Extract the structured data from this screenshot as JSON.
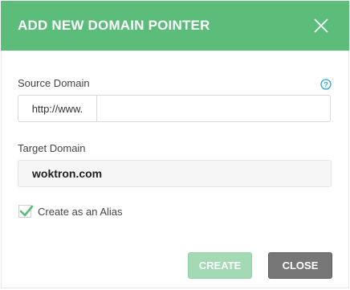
{
  "dialog": {
    "title": "ADD NEW DOMAIN POINTER",
    "close_icon": "close-x-icon"
  },
  "source": {
    "label": "Source Domain",
    "prefix": "http://www.",
    "value": "",
    "help_icon": "help-icon"
  },
  "target": {
    "label": "Target Domain",
    "value": "woktron.com"
  },
  "alias": {
    "label": "Create as an Alias",
    "checked": true
  },
  "buttons": {
    "create": "CREATE",
    "close": "CLOSE"
  },
  "colors": {
    "header": "#5cbd7b",
    "create_button": "#a3d9b3",
    "close_button": "#777777",
    "help_icon": "#2aa7de",
    "check": "#5cbd7b"
  }
}
